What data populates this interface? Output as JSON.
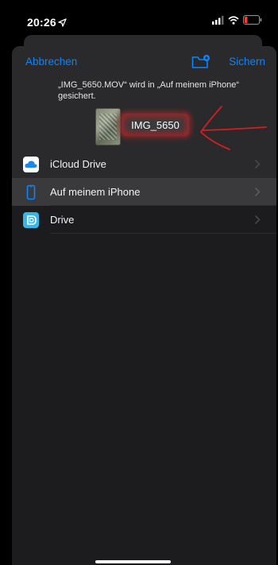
{
  "status_bar": {
    "time": "20:26",
    "location_icon": "location-arrow-icon",
    "signal_icon": "cellular-signal-icon",
    "wifi_icon": "wifi-icon",
    "battery_icon": "battery-icon",
    "battery_color": "#ff3b30"
  },
  "sheet": {
    "cancel_label": "Abbrechen",
    "new_folder_icon": "new-folder-icon",
    "save_label": "Sichern",
    "message": "„IMG_5650.MOV“ wird in „Auf meinem iPhone“ gesichert.",
    "file_name_value": "IMG_5650",
    "accent_color": "#0a84ff"
  },
  "locations": [
    {
      "label": "iCloud Drive",
      "icon": "icloud-icon",
      "selected": false
    },
    {
      "label": "Auf meinem iPhone",
      "icon": "iphone-icon",
      "selected": true
    },
    {
      "label": "Drive",
      "icon": "drive-icon",
      "selected": false
    }
  ]
}
